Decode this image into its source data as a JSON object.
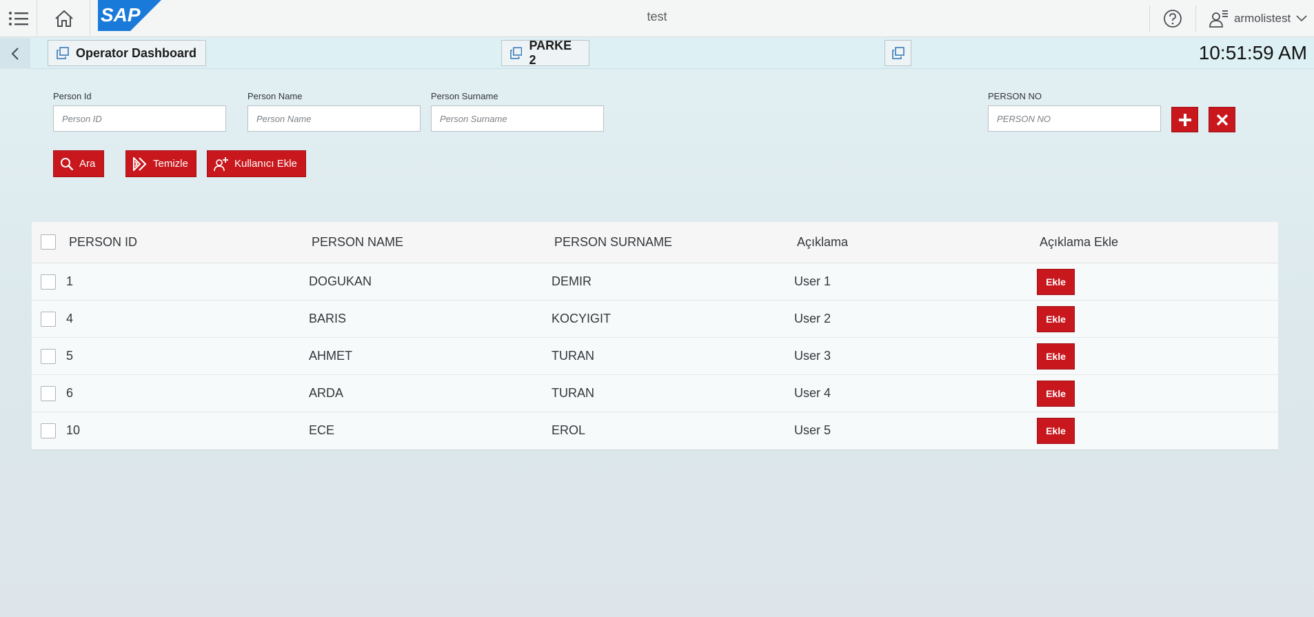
{
  "shell": {
    "title": "test",
    "logo_text": "SAP",
    "user_name": "armolistest",
    "icons": {
      "menu": "menu-icon",
      "home": "home-icon",
      "help": "help-icon",
      "user": "user-settings-icon",
      "dropdown": "chevron-down-icon"
    }
  },
  "subheader": {
    "back_icon": "chevron-left-icon",
    "dashboard_label": "Operator Dashboard",
    "parke_label": "PARKE 2",
    "clock": "10:51:59 AM"
  },
  "form": {
    "person_id": {
      "label": "Person Id",
      "placeholder": "Person ID",
      "value": ""
    },
    "person_name": {
      "label": "Person Name",
      "placeholder": "Person Name",
      "value": ""
    },
    "person_surname": {
      "label": "Person Surname",
      "placeholder": "Person Surname",
      "value": ""
    },
    "person_no": {
      "label": "PERSON NO",
      "placeholder": "PERSON NO",
      "value": ""
    },
    "search_label": "Ara",
    "clear_label": "Temizle",
    "add_user_label": "Kullanıcı Ekle"
  },
  "table": {
    "headers": [
      "PERSON ID",
      "PERSON NAME",
      "PERSON SURNAME",
      "Açıklama",
      "Açıklama Ekle"
    ],
    "rows": [
      {
        "id": "1",
        "name": "DOGUKAN",
        "surname": "DEMIR",
        "aciklama": "User 1",
        "action": "Ekle"
      },
      {
        "id": "4",
        "name": "BARIS",
        "surname": "KOCYIGIT",
        "aciklama": "User 2",
        "action": "Ekle"
      },
      {
        "id": "5",
        "name": "AHMET",
        "surname": "TURAN",
        "aciklama": "User 3",
        "action": "Ekle"
      },
      {
        "id": "6",
        "name": "ARDA",
        "surname": "TURAN",
        "aciklama": "User 4",
        "action": "Ekle"
      },
      {
        "id": "10",
        "name": "ECE",
        "surname": "EROL",
        "aciklama": "User 5",
        "action": "Ekle"
      }
    ]
  },
  "colors": {
    "accent_red": "#c8171d",
    "sap_blue": "#1a7ad9",
    "shell_bg": "#f4f5f5",
    "page_bg": "#e3f1f4"
  }
}
